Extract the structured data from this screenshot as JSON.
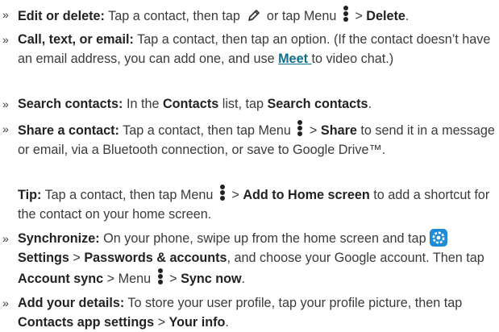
{
  "bullet": "»",
  "edit": {
    "title": "Edit or delete:",
    "t1": " Tap a contact, then tap ",
    "t2": " or tap Menu ",
    "t3": " > ",
    "b1": "Delete",
    "t4": "."
  },
  "call": {
    "title": "Call, text, or email:",
    "t1": " Tap a contact, then tap an option. (If the contact doesn’t have an email address, you can add one, and use ",
    "link": "Meet ",
    "t2": "to video chat.)"
  },
  "search": {
    "title": "Search contacts:",
    "t1": " In the ",
    "b1": "Contacts",
    "t2": " list, tap ",
    "b2": "Search contacts",
    "t3": "."
  },
  "share": {
    "title": "Share a contact:",
    "t1": " Tap a contact, then tap Menu ",
    "t2": " > ",
    "b1": "Share",
    "t3": " to send it in a message or email, via a Bluetooth connection, or save to Google Drive™."
  },
  "tip": {
    "title": "Tip:",
    "t1": " Tap a contact, then tap Menu ",
    "t2": " > ",
    "b1": "Add to Home screen",
    "t3": " to add a shortcut for the contact on your home screen."
  },
  "sync": {
    "title": "Synchronize:",
    "t1": " On your phone, swipe up from the home screen and tap ",
    "b1": "Settings",
    "t2": " > ",
    "b2": "Passwords & accounts",
    "t3": ", and choose your Google account. Then tap ",
    "b3": "Account sync",
    "t4": " > Menu ",
    "t5": " > ",
    "b4": "Sync now",
    "t6": "."
  },
  "details": {
    "title": "Add your details:",
    "t1": " To store your user profile, tap your profile picture, then tap ",
    "b1": "Contacts app settings",
    "t2": " > ",
    "b2": "Your info",
    "t3": "."
  },
  "icons": {
    "pencil": "pencil-icon",
    "menu": "menu-dots-icon",
    "settings": "settings-gear-icon"
  },
  "colors": {
    "text": "#3a3a3a",
    "link": "#0d6e8c",
    "settings_icon_bg": "#1e8bd6"
  }
}
